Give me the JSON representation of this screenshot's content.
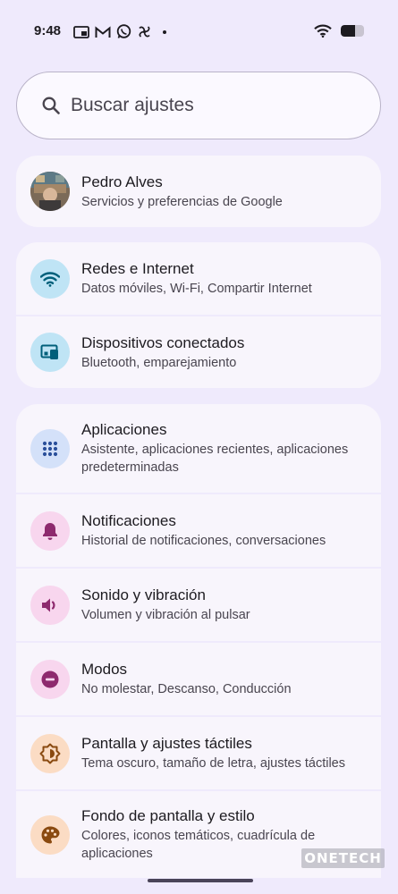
{
  "status_bar": {
    "time": "9:48",
    "battery_level": 0.6
  },
  "search": {
    "placeholder": "Buscar ajustes"
  },
  "account": {
    "name": "Pedro Alves",
    "subtitle": "Servicios y preferencias de Google"
  },
  "groups": [
    {
      "items": [
        {
          "title": "Redes e Internet",
          "subtitle": "Datos móviles, Wi-Fi, Compartir Internet",
          "icon": "wifi-icon",
          "color": "#bfe4f5"
        },
        {
          "title": "Dispositivos conectados",
          "subtitle": "Bluetooth, emparejamiento",
          "icon": "connected-devices-icon",
          "color": "#bfe4f5"
        }
      ]
    },
    {
      "items": [
        {
          "title": "Aplicaciones",
          "subtitle": "Asistente, aplicaciones recientes, aplicaciones predeterminadas",
          "icon": "apps-grid-icon",
          "color": "#d4e1f9"
        },
        {
          "title": "Notificaciones",
          "subtitle": "Historial de notificaciones, conversaciones",
          "icon": "bell-icon",
          "color": "#f8d6ee"
        },
        {
          "title": "Sonido y vibración",
          "subtitle": "Volumen y vibración al pulsar",
          "icon": "speaker-icon",
          "color": "#f8d6ee"
        },
        {
          "title": "Modos",
          "subtitle": "No molestar, Descanso, Conducción",
          "icon": "do-not-disturb-icon",
          "color": "#f8d6ee"
        },
        {
          "title": "Pantalla y ajustes táctiles",
          "subtitle": "Tema oscuro, tamaño de letra, ajustes táctiles",
          "icon": "brightness-icon",
          "color": "#fbdcc4"
        },
        {
          "title": "Fondo de pantalla y estilo",
          "subtitle": "Colores, iconos temáticos, cuadrícula de aplicaciones",
          "icon": "palette-icon",
          "color": "#fbdcc4"
        }
      ]
    }
  ],
  "watermark": "ONETECH"
}
